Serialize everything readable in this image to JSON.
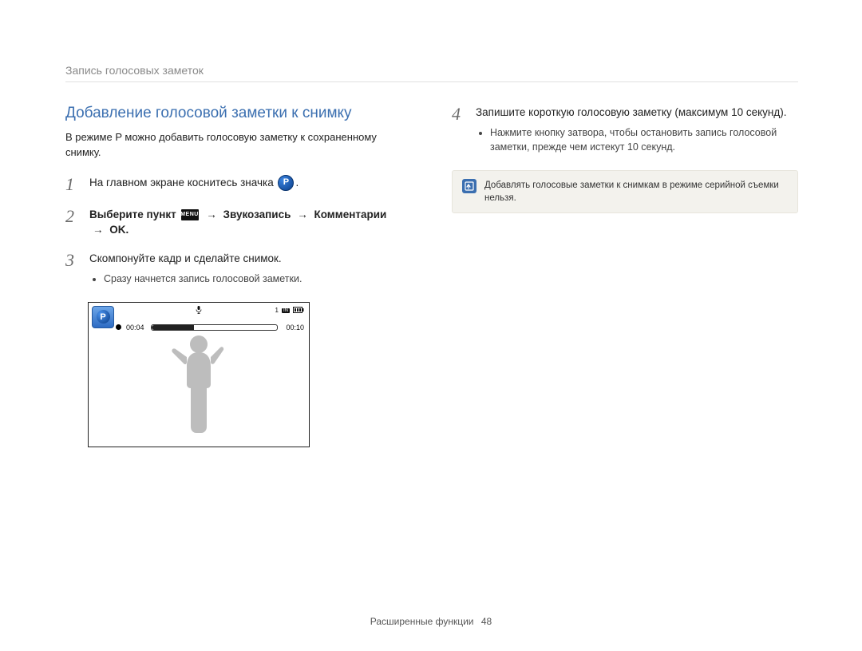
{
  "breadcrumb": "Запись голосовых заметок",
  "section_title": "Добавление голосовой заметки к снимку",
  "intro": "В режиме P можно добавить голосовую заметку к сохраненному снимку.",
  "steps": {
    "s1": {
      "num": "1",
      "text_before_icon": "На главном экране коснитесь значка",
      "text_after_icon": "."
    },
    "s2": {
      "num": "2",
      "prefix": "Выберите пункт",
      "menu_label": "MENU",
      "path1": "Звукозапись",
      "path2": "Комментарии",
      "ok": "OK",
      "arrow": "→",
      "period": "."
    },
    "s3": {
      "num": "3",
      "text": "Скомпонуйте кадр и сделайте снимок.",
      "bullet": "Сразу начнется запись голосовой заметки."
    },
    "s4": {
      "num": "4",
      "text": "Запишите короткую голосовую заметку (максимум 10 секунд).",
      "bullet": "Нажмите кнопку затвора, чтобы остановить запись голосовой заметки, прежде чем истекут 10 секунд."
    }
  },
  "camera": {
    "elapsed": "00:04",
    "total": "00:10",
    "count": "1",
    "in_label": "IN"
  },
  "note": "Добавлять голосовые заметки к снимкам в режиме серийной съемки нельзя.",
  "footer": {
    "section": "Расширенные функции",
    "page": "48"
  }
}
